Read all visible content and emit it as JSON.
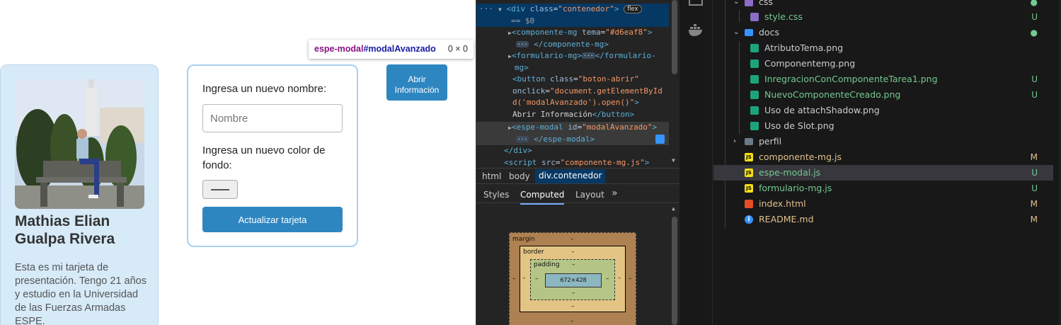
{
  "page": {
    "tooltip": {
      "tag": "espe-modal",
      "id": "#modalAvanzado",
      "dims": "0 × 0"
    },
    "card": {
      "name": "Mathias Elian Gualpa Rivera",
      "description": "Esta es mi tarjeta de presentación. Tengo 21 años y estudio en la Universidad de las Fuerzas Armadas ESPE."
    },
    "form": {
      "name_label": "Ingresa un nuevo nombre:",
      "name_placeholder": "Nombre",
      "color_label": "Ingresa un nuevo color de fondo:",
      "submit_label": "Actualizar tarjeta"
    },
    "open_button_label": "Abrir Información",
    "colors": {
      "card_bg": "#d6eaf8",
      "button": "#2e86c1",
      "form_border": "#a9d0f0"
    }
  },
  "devtools": {
    "code": {
      "l1": {
        "open": "<div",
        "attr": "class",
        "val": "\"contenedor\"",
        "close": ">",
        "pill": "flex"
      },
      "l2": "== $0",
      "l3": {
        "open": "<componente-mg",
        "attr": "tema",
        "val": "\"#d6eaf8\"",
        "close": ">"
      },
      "l4": "</componente-mg>",
      "l5": {
        "open": "<formulario-mg>",
        "close": "</formulario-"
      },
      "l6": "mg>",
      "l7": {
        "open": "<button",
        "attr": "class",
        "val": "\"boton-abrir\""
      },
      "l8": {
        "attr": "onclick",
        "val": "\"document.getElementById"
      },
      "l9": {
        "val": "d('modalAvanzado').open()\"",
        "close": ">"
      },
      "l10": {
        "text": "Abrir Información",
        "close": "</button>"
      },
      "l11": {
        "open": "<espe-modal",
        "attr": "id",
        "val": "\"modalAvanzado\"",
        "close": ">"
      },
      "l12": "</espe-modal>",
      "l13": "</div>",
      "l14": {
        "open": "<script",
        "attr": "src",
        "val": "\"componente-mg.js\"",
        "close": ">"
      }
    },
    "breadcrumbs": [
      "html",
      "body",
      "div.contenedor"
    ],
    "tabs": [
      "Styles",
      "Computed",
      "Layout"
    ],
    "box_model": {
      "margin": "margin",
      "border": "border",
      "padding": "padding",
      "content": "672×428",
      "dash": "–"
    }
  },
  "vscode": {
    "tree": [
      {
        "label": "css",
        "type": "folder",
        "indicator": "●"
      },
      {
        "label": "style.css",
        "type": "css",
        "indicator": "U",
        "status": "untracked"
      },
      {
        "label": "docs",
        "type": "docs-folder",
        "indicator": "●"
      },
      {
        "label": "AtributoTema.png",
        "type": "image",
        "indicator": "",
        "status": "none"
      },
      {
        "label": "Componentemg.png",
        "type": "image",
        "indicator": "",
        "status": "none"
      },
      {
        "label": "InregracionConComponenteTarea1.png",
        "type": "image",
        "indicator": "U",
        "status": "untracked"
      },
      {
        "label": "NuevoComponenteCreado.png",
        "type": "image",
        "indicator": "U",
        "status": "untracked"
      },
      {
        "label": "Uso de attachShadow.png",
        "type": "image",
        "indicator": "",
        "status": "none"
      },
      {
        "label": "Uso de Slot.png",
        "type": "image",
        "indicator": "",
        "status": "none"
      },
      {
        "label": "perfil",
        "type": "folder",
        "indicator": "",
        "status": "none"
      },
      {
        "label": "componente-mg.js",
        "type": "js",
        "indicator": "M",
        "status": "modified"
      },
      {
        "label": "espe-modal.js",
        "type": "js",
        "indicator": "U",
        "status": "untracked"
      },
      {
        "label": "formulario-mg.js",
        "type": "js",
        "indicator": "U",
        "status": "untracked"
      },
      {
        "label": "index.html",
        "type": "html",
        "indicator": "M",
        "status": "modified"
      },
      {
        "label": "README.md",
        "type": "info",
        "indicator": "M",
        "status": "modified"
      }
    ],
    "colors": {
      "untracked": "#73c991",
      "modified": "#e2c08d",
      "none": "#cccccc"
    }
  }
}
